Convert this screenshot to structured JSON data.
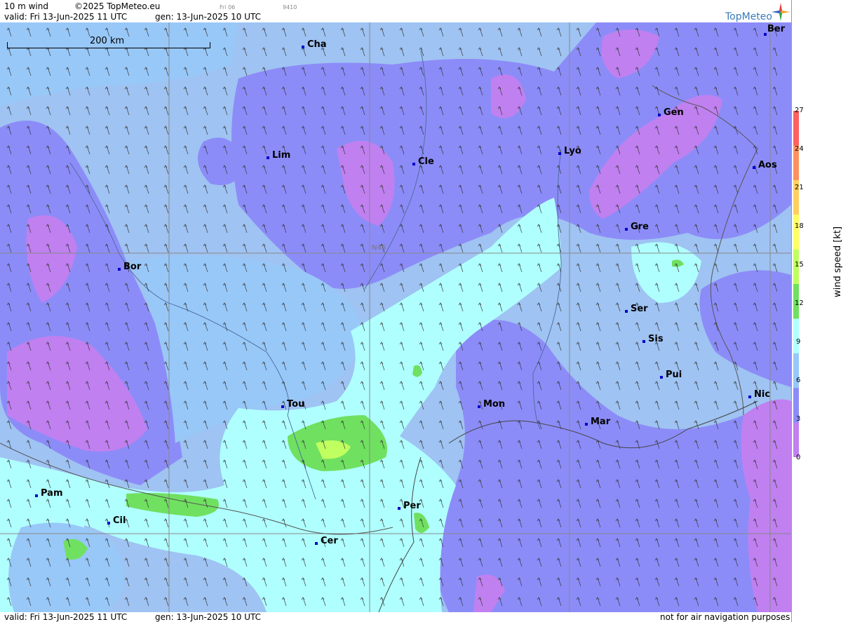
{
  "header": {
    "product": "10 m wind",
    "copyright": "©2025 TopMeteo.eu",
    "day": "Fri 06",
    "code": "9410",
    "valid": "valid:  Fri  13-Jun-2025  11 UTC",
    "gen": "gen: 13-Jun-2025 10 UTC"
  },
  "logo": {
    "text": "TopMeteo",
    "colors": [
      "#e04040",
      "#f0a020",
      "#30a040",
      "#3060c0"
    ]
  },
  "scale": {
    "label": "200 km"
  },
  "latitude_label": "N45",
  "cities": [
    {
      "name": "Cha"
    },
    {
      "name": "Ber"
    },
    {
      "name": "Gen"
    },
    {
      "name": "Lim"
    },
    {
      "name": "Cle"
    },
    {
      "name": "Lyo"
    },
    {
      "name": "Aos"
    },
    {
      "name": "Gre"
    },
    {
      "name": "Bor"
    },
    {
      "name": "Ser"
    },
    {
      "name": "Sis"
    },
    {
      "name": "Pui"
    },
    {
      "name": "Tou"
    },
    {
      "name": "Mon"
    },
    {
      "name": "Nic"
    },
    {
      "name": "Mar"
    },
    {
      "name": "Pam"
    },
    {
      "name": "Cil"
    },
    {
      "name": "Per"
    },
    {
      "name": "Cer"
    }
  ],
  "legend": {
    "title": "wind speed [kt]",
    "ticks": [
      "27",
      "24",
      "21",
      "18",
      "15",
      "12",
      "9",
      "6",
      "3",
      "0"
    ],
    "colors": [
      "#ff6060",
      "#ff9060",
      "#ffd060",
      "#ffff60",
      "#c0ff60",
      "#70e060",
      "#b0ffff",
      "#98c8f8",
      "#8c8cf8",
      "#c080f0"
    ]
  },
  "footer": {
    "valid": "valid:  Fri  13-Jun-2025  11 UTC",
    "gen": "gen: 13-Jun-2025 10 UTC",
    "disclaimer": "not for air navigation purposes"
  }
}
